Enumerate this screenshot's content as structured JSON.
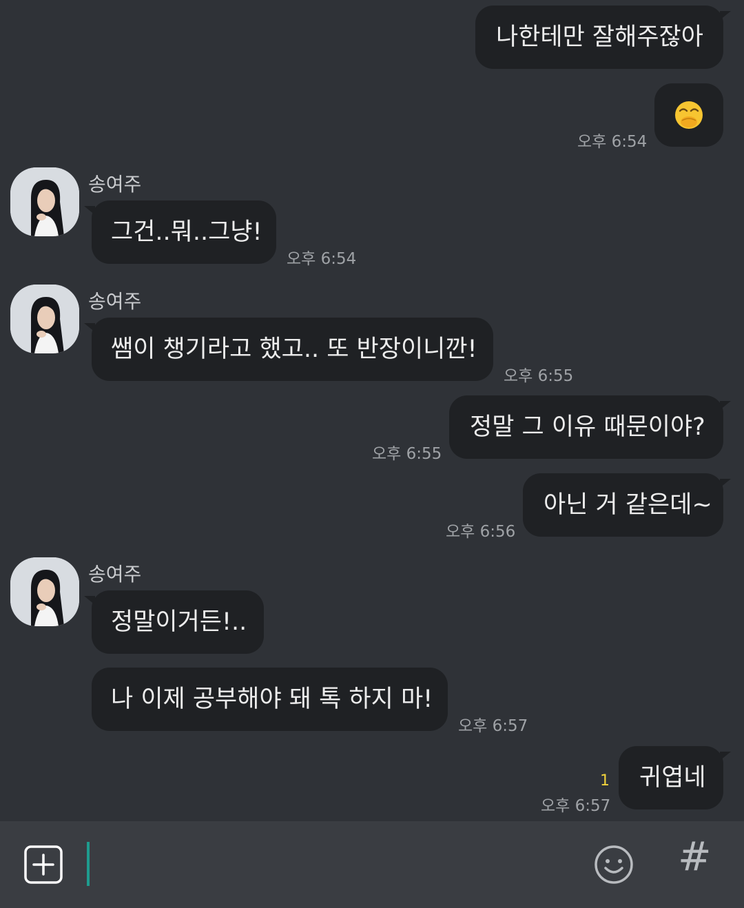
{
  "contact": {
    "name": "송여주"
  },
  "messages": [
    {
      "id": "m1",
      "from": "me",
      "text": "나한테만 잘해주잖아"
    },
    {
      "id": "m2",
      "from": "me",
      "emoji": "face-with-hand-over-mouth",
      "time": "오후 6:54"
    },
    {
      "id": "m3",
      "from": "other",
      "text": "그건..뭐..그냥!",
      "time": "오후 6:54"
    },
    {
      "id": "m4",
      "from": "other",
      "text": "쌤이 챙기라고 했고.. 또 반장이니깐!",
      "time": "오후 6:55"
    },
    {
      "id": "m5",
      "from": "me",
      "text": "정말 그 이유 때문이야?",
      "time": "오후 6:55"
    },
    {
      "id": "m6",
      "from": "me",
      "text": "아닌 거 같은데~",
      "time": "오후 6:56"
    },
    {
      "id": "m7",
      "from": "other",
      "text": "정말이거든!.."
    },
    {
      "id": "m8",
      "from": "other",
      "text": "나 이제 공부해야 돼 톡 하지 마!",
      "time": "오후 6:57"
    },
    {
      "id": "m9",
      "from": "me",
      "text": "귀엽네",
      "time": "오후 6:57",
      "unread": "1"
    }
  ],
  "input_bar": {
    "plus_icon": "plus-square-icon",
    "emoji_icon": "smiley-icon",
    "hash_label": "#"
  },
  "colors": {
    "background": "#2f3237",
    "bubble": "#1f2124",
    "input_bar": "#3a3d42",
    "caret": "#1e9c8e",
    "unread": "#f2d33c"
  }
}
